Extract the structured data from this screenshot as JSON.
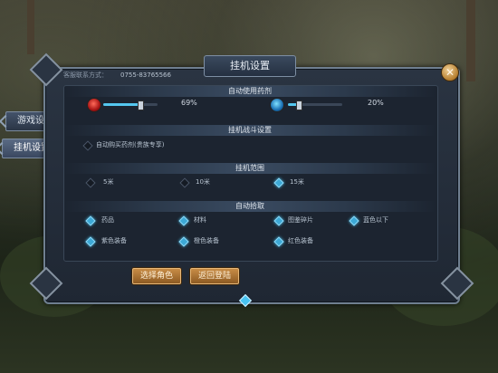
{
  "title": "挂机设置",
  "contact": {
    "label": "客服联系方式：",
    "number": "0755-83765566"
  },
  "side_tabs": [
    {
      "label": "游戏设置",
      "active": false
    },
    {
      "label": "挂机设置",
      "active": true
    }
  ],
  "sections": {
    "potion": "自动使用药剂",
    "battle": "挂机战斗设置",
    "range": "挂机范围",
    "pickup": "自动拾取"
  },
  "potions": [
    {
      "icon": "red-potion-icon",
      "percent_label": "69%",
      "level": 0.69,
      "color": "#54c6ef"
    },
    {
      "icon": "blue-potion-icon",
      "percent_label": "20%",
      "level": 0.2,
      "color": "#54c6ef"
    }
  ],
  "battle_option": {
    "label": "自动购买药剂(贵族专享)",
    "checked": false
  },
  "range_options": [
    {
      "label": "5米",
      "selected": false
    },
    {
      "label": "10米",
      "selected": false
    },
    {
      "label": "15米",
      "selected": true
    }
  ],
  "pickup_options": [
    {
      "label": "药品",
      "checked": true
    },
    {
      "label": "材料",
      "checked": true
    },
    {
      "label": "图鉴碎片",
      "checked": true
    },
    {
      "label": "蓝色以下",
      "checked": true
    },
    {
      "label": "紫色装备",
      "checked": true
    },
    {
      "label": "橙色装备",
      "checked": true
    },
    {
      "label": "红色装备",
      "checked": true
    }
  ],
  "buttons": {
    "select_role": "选择角色",
    "back_login": "返回登陆"
  },
  "close_symbol": "✕",
  "colors": {
    "accent": "#54c6ef",
    "gold": "#c88c46"
  }
}
